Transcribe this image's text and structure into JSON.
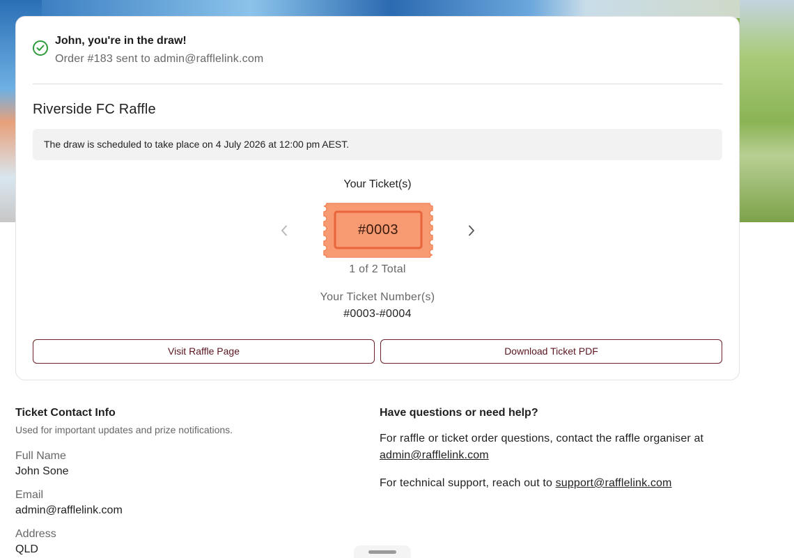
{
  "confirmation": {
    "title": "John, you're in the draw!",
    "subtitle": "Order #183 sent to admin@rafflelink.com"
  },
  "raffle": {
    "title": "Riverside FC Raffle",
    "notice": "The draw is scheduled to take place on 4 July 2026 at 12:00 pm AEST."
  },
  "tickets": {
    "label": "Your Ticket(s)",
    "current": "#0003",
    "count_text": "1 of 2 Total",
    "numbers_label": "Your Ticket Number(s)",
    "numbers_value": "#0003-#0004",
    "ticket_color": "#f79a72",
    "ticket_border_color": "#e8643a"
  },
  "actions": {
    "visit_label": "Visit Raffle Page",
    "download_label": "Download Ticket PDF",
    "button_color": "#6b1f28"
  },
  "contact": {
    "title": "Ticket Contact Info",
    "subtitle": "Used for important updates and prize notifications.",
    "fields": [
      {
        "label": "Full Name",
        "value": "John Sone"
      },
      {
        "label": "Email",
        "value": "admin@rafflelink.com"
      },
      {
        "label": "Address",
        "value": "QLD"
      }
    ]
  },
  "help": {
    "title": "Have questions or need help?",
    "organiser_text": "For raffle or ticket order questions, contact the raffle organiser at ",
    "organiser_email": "admin@rafflelink.com",
    "support_text": "For technical support, reach out to ",
    "support_email": "support@rafflelink.com"
  },
  "icons": {
    "success": "check-circle-icon",
    "prev": "chevron-left-icon",
    "next": "chevron-right-icon"
  },
  "colors": {
    "success": "#2e9b3a"
  }
}
